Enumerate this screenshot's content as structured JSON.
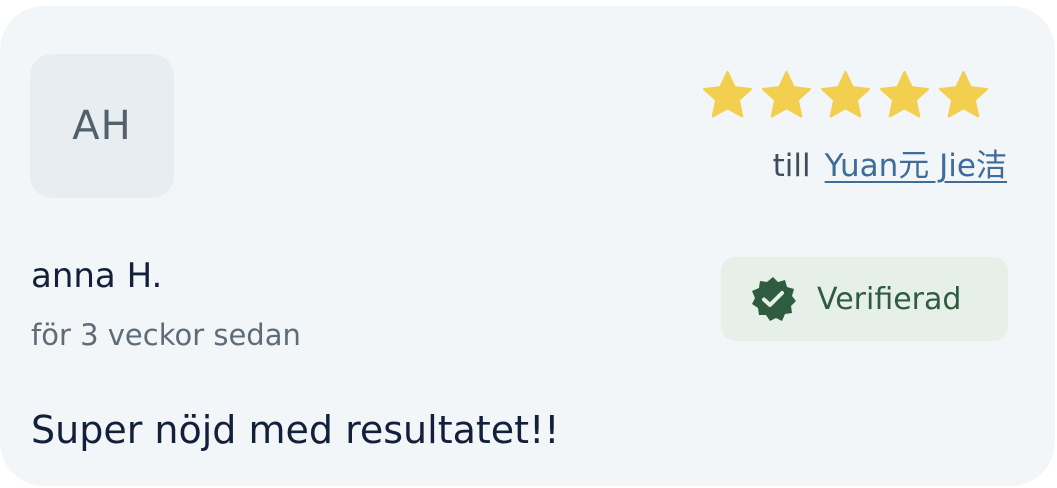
{
  "review": {
    "avatar_initials": "AH",
    "rating": 5,
    "rating_max": 5,
    "recipient_prefix": "till",
    "recipient_name": "Yuan元 Jie洁",
    "reviewer_name": "anna H.",
    "time_ago": "för 3 veckor sedan",
    "verified_label": "Verifierad",
    "text": "Super nöjd med resultatet!!"
  },
  "colors": {
    "card_background": "#f2f6f9",
    "avatar_background": "#e8edf1",
    "star": "#f2cf4f",
    "link": "#3d6d98",
    "verified_background": "#e7efe9",
    "verified_green": "#2f5c3f",
    "text_primary": "#12203a",
    "text_secondary": "#5f6c78"
  }
}
